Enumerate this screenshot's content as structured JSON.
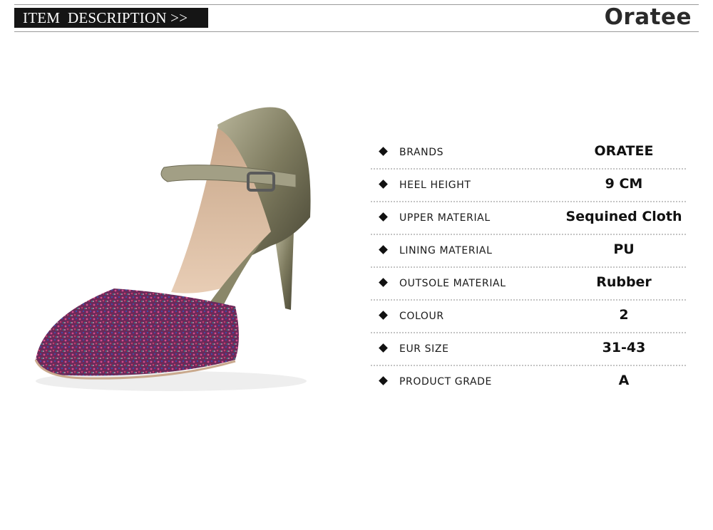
{
  "header": {
    "section_title": "ITEM  DESCRIPTION >>",
    "brand_logo": "Oratee"
  },
  "colors": {
    "banner_bg": "#151515",
    "glitter_toe": "#7a2b63",
    "metallic_heel": "#8d8a6a",
    "insole": "#d9b89b"
  },
  "product": {
    "icon": "high-heel-shoe-illustration"
  },
  "specs": [
    {
      "label": "BRANDS",
      "value": "ORATEE"
    },
    {
      "label": "HEEL HEIGHT",
      "value": "9 CM"
    },
    {
      "label": "UPPER MATERIAL",
      "value": "Sequined Cloth"
    },
    {
      "label": "LINING MATERIAL",
      "value": "PU"
    },
    {
      "label": "OUTSOLE MATERIAL",
      "value": "Rubber"
    },
    {
      "label": "COLOUR",
      "value": "2"
    },
    {
      "label": "EUR SIZE",
      "value": "31-43"
    },
    {
      "label": "PRODUCT GRADE",
      "value": "A"
    }
  ]
}
